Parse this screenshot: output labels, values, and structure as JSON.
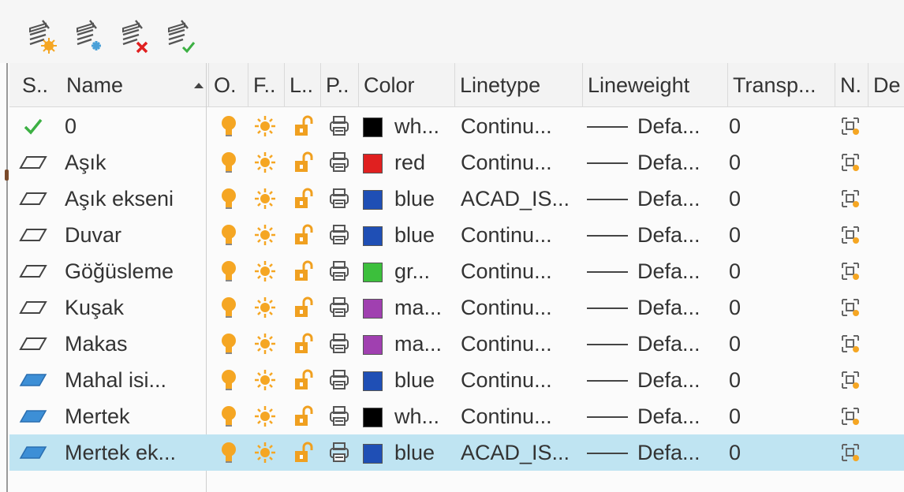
{
  "toolbar": {
    "buttons": [
      {
        "name": "new-layer-button",
        "icon": "layer-new-icon"
      },
      {
        "name": "new-layer-vp-frozen-button",
        "icon": "layer-new-vp-frozen-icon"
      },
      {
        "name": "delete-layer-button",
        "icon": "layer-delete-icon"
      },
      {
        "name": "set-current-button",
        "icon": "layer-set-current-icon"
      }
    ]
  },
  "columns": {
    "status": "S..",
    "name": "Name",
    "on": "O.",
    "freeze": "F..",
    "lock": "L..",
    "plot": "P..",
    "color": "Color",
    "linetype": "Linetype",
    "lineweight": "Lineweight",
    "transparency": "Transp...",
    "new_vp_freeze": "N.",
    "description": "De"
  },
  "colors": {
    "selection": "#bfe4f2",
    "current_check": "#3cb043",
    "bulb": "#f5a623",
    "sun": "#f5a623",
    "lock": "#f0a020"
  },
  "layers": [
    {
      "status": "current",
      "name": "0",
      "color_swatch": "#000000",
      "color_name": "wh...",
      "linetype": "Continu...",
      "lineweight": "Defa...",
      "transparency": "0",
      "selected": false
    },
    {
      "status": "layer-empty",
      "name": "Aşık",
      "color_swatch": "#e02020",
      "color_name": "red",
      "linetype": "Continu...",
      "lineweight": "Defa...",
      "transparency": "0",
      "selected": false
    },
    {
      "status": "layer-empty",
      "name": "Aşık ekseni",
      "color_swatch": "#1f4fb5",
      "color_name": "blue",
      "linetype": "ACAD_IS...",
      "lineweight": "Defa...",
      "transparency": "0",
      "selected": false
    },
    {
      "status": "layer-empty",
      "name": "Duvar",
      "color_swatch": "#1f4fb5",
      "color_name": "blue",
      "linetype": "Continu...",
      "lineweight": "Defa...",
      "transparency": "0",
      "selected": false
    },
    {
      "status": "layer-empty",
      "name": "Göğüsleme",
      "color_swatch": "#3cbf3c",
      "color_name": "gr...",
      "linetype": "Continu...",
      "lineweight": "Defa...",
      "transparency": "0",
      "selected": false
    },
    {
      "status": "layer-empty",
      "name": "Kuşak",
      "color_swatch": "#a040b0",
      "color_name": "ma...",
      "linetype": "Continu...",
      "lineweight": "Defa...",
      "transparency": "0",
      "selected": false
    },
    {
      "status": "layer-empty",
      "name": "Makas",
      "color_swatch": "#a040b0",
      "color_name": "ma...",
      "linetype": "Continu...",
      "lineweight": "Defa...",
      "transparency": "0",
      "selected": false
    },
    {
      "status": "layer-used",
      "name": "Mahal isi...",
      "color_swatch": "#1f4fb5",
      "color_name": "blue",
      "linetype": "Continu...",
      "lineweight": "Defa...",
      "transparency": "0",
      "selected": false
    },
    {
      "status": "layer-used",
      "name": "Mertek",
      "color_swatch": "#000000",
      "color_name": "wh...",
      "linetype": "Continu...",
      "lineweight": "Defa...",
      "transparency": "0",
      "selected": false
    },
    {
      "status": "layer-used",
      "name": "Mertek ek...",
      "color_swatch": "#1f4fb5",
      "color_name": "blue",
      "linetype": "ACAD_IS...",
      "lineweight": "Defa...",
      "transparency": "0",
      "selected": true
    }
  ]
}
